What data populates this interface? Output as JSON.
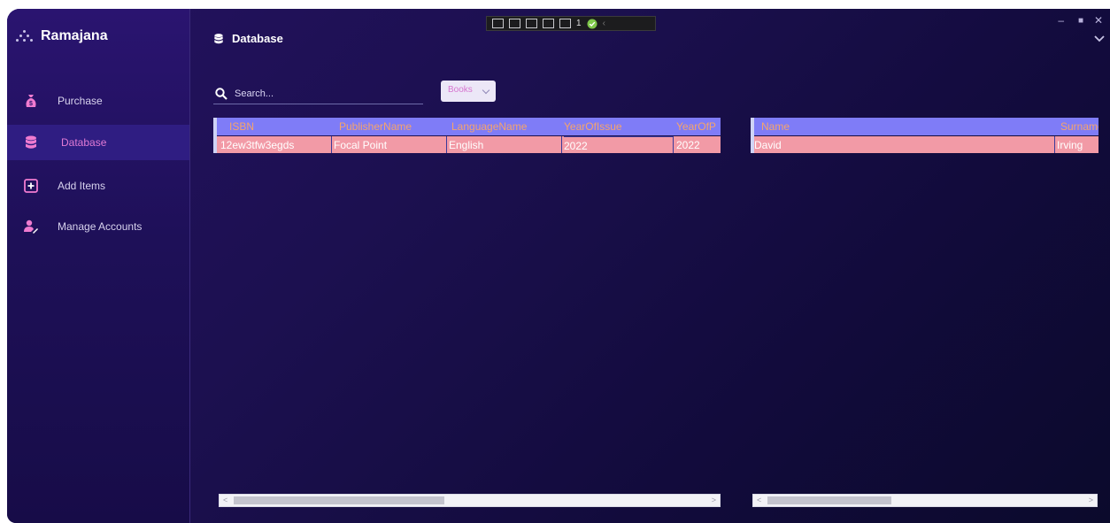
{
  "app": {
    "title": "Ramajana"
  },
  "sidebar": {
    "items": [
      {
        "label": "Purchase",
        "icon": "money-bag-icon",
        "active": false
      },
      {
        "label": "Database",
        "icon": "database-icon",
        "active": true
      },
      {
        "label": "Add Items",
        "icon": "plus-square-icon",
        "active": false
      },
      {
        "label": "Manage Accounts",
        "icon": "user-edit-icon",
        "active": false
      }
    ]
  },
  "main": {
    "title": "Database",
    "search": {
      "placeholder": "Search..."
    },
    "filter": {
      "selected": "Books"
    }
  },
  "books_grid": {
    "columns": [
      "ISBN",
      "PublisherName",
      "LanguageName",
      "YearOfIssue",
      "YearOfP"
    ],
    "rows": [
      [
        "12ew3tfw3egds",
        "Focal Point",
        "English",
        "2022",
        "2022"
      ]
    ]
  },
  "authors_grid": {
    "columns": [
      "Name",
      "Surname"
    ],
    "rows": [
      [
        "David",
        "Irving"
      ]
    ]
  },
  "debug_toolbar": {
    "counter": "1"
  },
  "colors": {
    "accent": "#e07ad4",
    "header_row": "#7f7cf7",
    "data_row": "#f29aa6",
    "header_text": "#f6a46b"
  }
}
